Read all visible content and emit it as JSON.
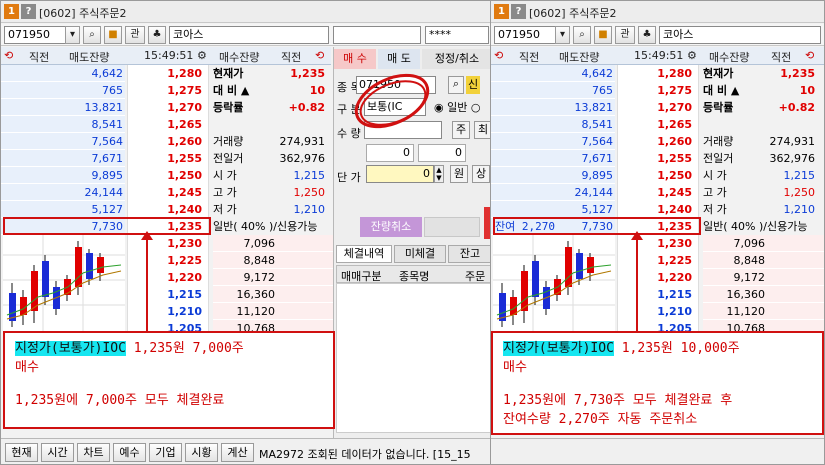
{
  "left": {
    "title": "[0602] 주식주문2",
    "code": "071950",
    "rel_btn": "관",
    "name": "코아스",
    "pw": "****",
    "head": {
      "left": "직전",
      "ask": "매도잔량",
      "time": "15:49:51",
      "bid": "매수잔량",
      "right": "직전"
    },
    "asks": [
      {
        "qty": "4,642",
        "price": "1,280"
      },
      {
        "qty": "765",
        "price": "1,275"
      },
      {
        "qty": "13,821",
        "price": "1,270"
      },
      {
        "qty": "8,541",
        "price": "1,265"
      },
      {
        "qty": "7,564",
        "price": "1,260"
      },
      {
        "qty": "7,671",
        "price": "1,255"
      },
      {
        "qty": "9,895",
        "price": "1,250"
      },
      {
        "qty": "24,144",
        "price": "1,245"
      },
      {
        "qty": "5,127",
        "price": "1,240"
      },
      {
        "qty": "7,730",
        "price": "1,235"
      }
    ],
    "info": [
      {
        "label": "현재가",
        "value": "1,235",
        "lbold": true,
        "vcolor": "#e00000",
        "vbold": true
      },
      {
        "label": "대  비  ▲",
        "value": "10",
        "lbold": true,
        "vcolor": "#e00000",
        "vbold": true
      },
      {
        "label": "등락률",
        "value": "+0.82",
        "lbold": true,
        "vcolor": "#e00000",
        "vbold": true
      },
      {
        "label": "",
        "value": ""
      },
      {
        "label": "거래량",
        "value": "274,931"
      },
      {
        "label": "전일거",
        "value": "362,976"
      },
      {
        "label": "시  가",
        "value": "1,215",
        "vcolor": "#0b3bd6"
      },
      {
        "label": "고  가",
        "value": "1,250",
        "vcolor": "#e00000"
      },
      {
        "label": "저  가",
        "value": "1,210",
        "vcolor": "#0b3bd6"
      },
      {
        "label": "일반( 40% )/신용가능",
        "value": ""
      }
    ],
    "bids": [
      {
        "price": "1,230",
        "qty": "7,096",
        "pcolor": "#e00000"
      },
      {
        "price": "1,225",
        "qty": "8,848",
        "pcolor": "#e00000"
      },
      {
        "price": "1,220",
        "qty": "9,172",
        "pcolor": "#e00000"
      },
      {
        "price": "1,215",
        "qty": "16,360",
        "pcolor": "#0b3bd6"
      },
      {
        "price": "1,210",
        "qty": "11,120",
        "pcolor": "#0b3bd6"
      },
      {
        "price": "1,205",
        "qty": "10,768",
        "pcolor": "#0b3bd6"
      }
    ],
    "order_panel": {
      "tabs": [
        "매 수",
        "매 도",
        "정정/취소"
      ],
      "row_labels": [
        "종 목",
        "구 분",
        "수 량",
        "",
        "단 가"
      ],
      "code": "071950",
      "type_select": "보통(IC",
      "radio1": "일반",
      "qty": "0",
      "num_a": "0",
      "num_b": "0",
      "price": "0",
      "unit_btn": "원",
      "main_btn": "신",
      "btn_ju": "주",
      "btn_choe": "최",
      "btn_sang": "상",
      "cancel_btn": "잔량취소",
      "bottom_tabs": [
        "체결내역",
        "미체결",
        "잔고"
      ],
      "grid_headers": [
        "매매구분",
        "종목명",
        "주문"
      ]
    },
    "callout": {
      "line1_hl": "지정가(보통가)IOC",
      "line1_rest": " 1,235원 7,000주",
      "line2": "매수",
      "line3": "1,235원에 7,000주 모두 체결완료"
    },
    "status": {
      "buttons": [
        "현재",
        "시간",
        "차트",
        "예수",
        "기업",
        "시황",
        "계산"
      ],
      "message": "MA2972 조회된 데이터가 없습니다. [15_15"
    }
  },
  "right": {
    "title": "[0602] 주식주문2",
    "code": "071950",
    "rel_btn": "관",
    "name": "코아스",
    "head": {
      "left": "직전",
      "ask": "매도잔량",
      "time": "15:49:51",
      "bid": "매수잔량",
      "right": "직전"
    },
    "asks": [
      {
        "qty": "4,642",
        "price": "1,280"
      },
      {
        "qty": "765",
        "price": "1,275"
      },
      {
        "qty": "13,821",
        "price": "1,270"
      },
      {
        "qty": "8,541",
        "price": "1,265"
      },
      {
        "qty": "7,564",
        "price": "1,260"
      },
      {
        "qty": "7,671",
        "price": "1,255"
      },
      {
        "qty": "9,895",
        "price": "1,250"
      },
      {
        "qty": "24,144",
        "price": "1,245"
      },
      {
        "qty": "5,127",
        "price": "1,240"
      },
      {
        "qty": "7,730",
        "price": "1,235"
      }
    ],
    "remain_label": "잔여 2,270",
    "info": [
      {
        "label": "현재가",
        "value": "1,235",
        "lbold": true,
        "vcolor": "#e00000",
        "vbold": true
      },
      {
        "label": "대  비  ▲",
        "value": "10",
        "lbold": true,
        "vcolor": "#e00000",
        "vbold": true
      },
      {
        "label": "등락률",
        "value": "+0.82",
        "lbold": true,
        "vcolor": "#e00000",
        "vbold": true
      },
      {
        "label": "",
        "value": ""
      },
      {
        "label": "거래량",
        "value": "274,931"
      },
      {
        "label": "전일거",
        "value": "362,976"
      },
      {
        "label": "시  가",
        "value": "1,215",
        "vcolor": "#0b3bd6"
      },
      {
        "label": "고  가",
        "value": "1,250",
        "vcolor": "#e00000"
      },
      {
        "label": "저  가",
        "value": "1,210",
        "vcolor": "#0b3bd6"
      },
      {
        "label": "일반( 40% )/신용가능",
        "value": ""
      }
    ],
    "bids": [
      {
        "price": "1,230",
        "qty": "7,096",
        "pcolor": "#e00000"
      },
      {
        "price": "1,225",
        "qty": "8,848",
        "pcolor": "#e00000"
      },
      {
        "price": "1,220",
        "qty": "9,172",
        "pcolor": "#e00000"
      },
      {
        "price": "1,215",
        "qty": "16,360",
        "pcolor": "#0b3bd6"
      },
      {
        "price": "1,210",
        "qty": "11,120",
        "pcolor": "#0b3bd6"
      },
      {
        "price": "1,205",
        "qty": "10,768",
        "pcolor": "#0b3bd6"
      }
    ],
    "callout": {
      "line1_hl": "지정가(보통가)IOC",
      "line1_rest": " 1,235원 10,000주",
      "line2": "매수",
      "line3": "1,235원에 7,730주 모두 체결완료 후",
      "line4": "잔여수량 2,270주 자동 주문취소"
    }
  },
  "colors": {
    "ask_bg": "#e8f0fb",
    "bid_bg": "#fdeeee",
    "highlight": "#16e6f0",
    "callout_border": "#d01010"
  }
}
